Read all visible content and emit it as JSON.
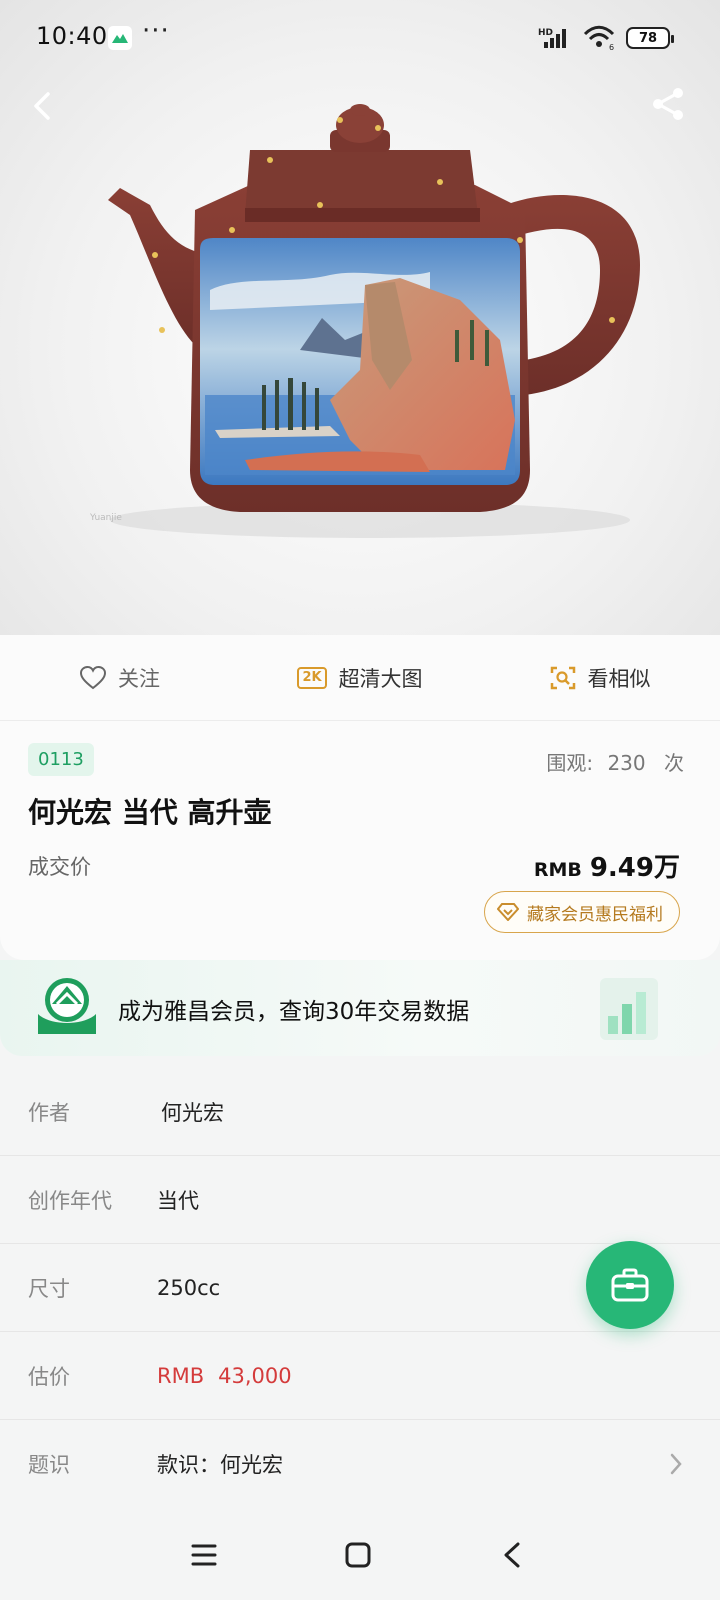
{
  "status_bar": {
    "time": "10:40",
    "dots": "···",
    "network_label": "HD",
    "wifi_sub": "6",
    "battery": "78"
  },
  "hero": {
    "back_icon": "chevron-left-icon",
    "share_icon": "share-icon"
  },
  "actions": {
    "follow_label": "关注",
    "hd_badge": "2K",
    "hd_label": "超清大图",
    "similar_label": "看相似"
  },
  "lot": {
    "number": "0113",
    "views_prefix": "围观:",
    "views_count": "230",
    "views_suffix": "次",
    "title": "何光宏 当代 高升壶",
    "deal_label": "成交价",
    "price_currency": "RMB",
    "price_value": "9.49万",
    "member_benefit": "藏家会员惠民福利"
  },
  "banner": {
    "text": "成为雅昌会员，查询30年交易数据"
  },
  "details": [
    {
      "label": "作者",
      "value": "何光宏"
    },
    {
      "label": "创作年代",
      "value": "当代"
    },
    {
      "label": "尺寸",
      "value": "250cc"
    },
    {
      "label": "估价",
      "value_currency": "RMB",
      "value": "43,000"
    },
    {
      "label": "题识",
      "value": "款识：何光宏"
    }
  ],
  "colors": {
    "accent_green": "#27b777",
    "price_red": "#d43b3b",
    "gold": "#d8a54c"
  }
}
